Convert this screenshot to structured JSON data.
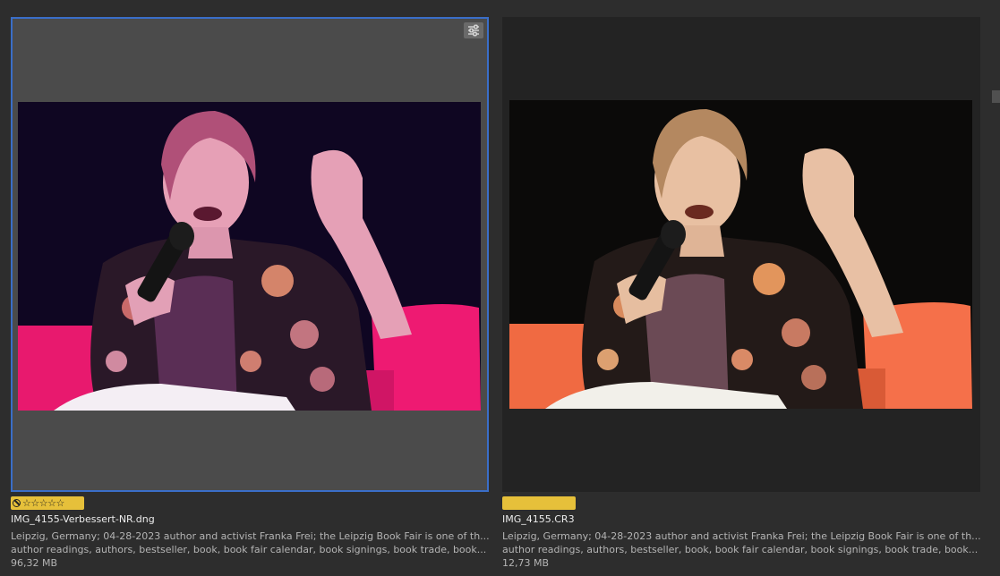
{
  "cards": [
    {
      "filename": "IMG_4155-Verbessert-NR.dng",
      "rating_text": "☆☆☆☆☆",
      "description": "Leipzig, Germany; 04-28-2023 author and activist Franka Frei; the Leipzig Book Fair is one of th...",
      "keywords": "author readings, authors, bestseller, book, book fair calendar, book signings, book trade, book...",
      "size": "96,32 MB",
      "selected": true,
      "icons": [
        "adjustments-icon",
        "reject-icon",
        "star-icon"
      ]
    },
    {
      "filename": "IMG_4155.CR3",
      "rating_text": "",
      "description": "Leipzig, Germany; 04-28-2023 author and activist Franka Frei; the Leipzig Book Fair is one of th...",
      "keywords": "author readings, authors, bestseller, book, book fair calendar, book signings, book trade, book...",
      "size": "12,73 MB",
      "selected": false
    }
  ],
  "colors": {
    "selection_border": "#3a6ec8",
    "rating_badge": "#e6c03a",
    "background": "#2d2d2d"
  }
}
